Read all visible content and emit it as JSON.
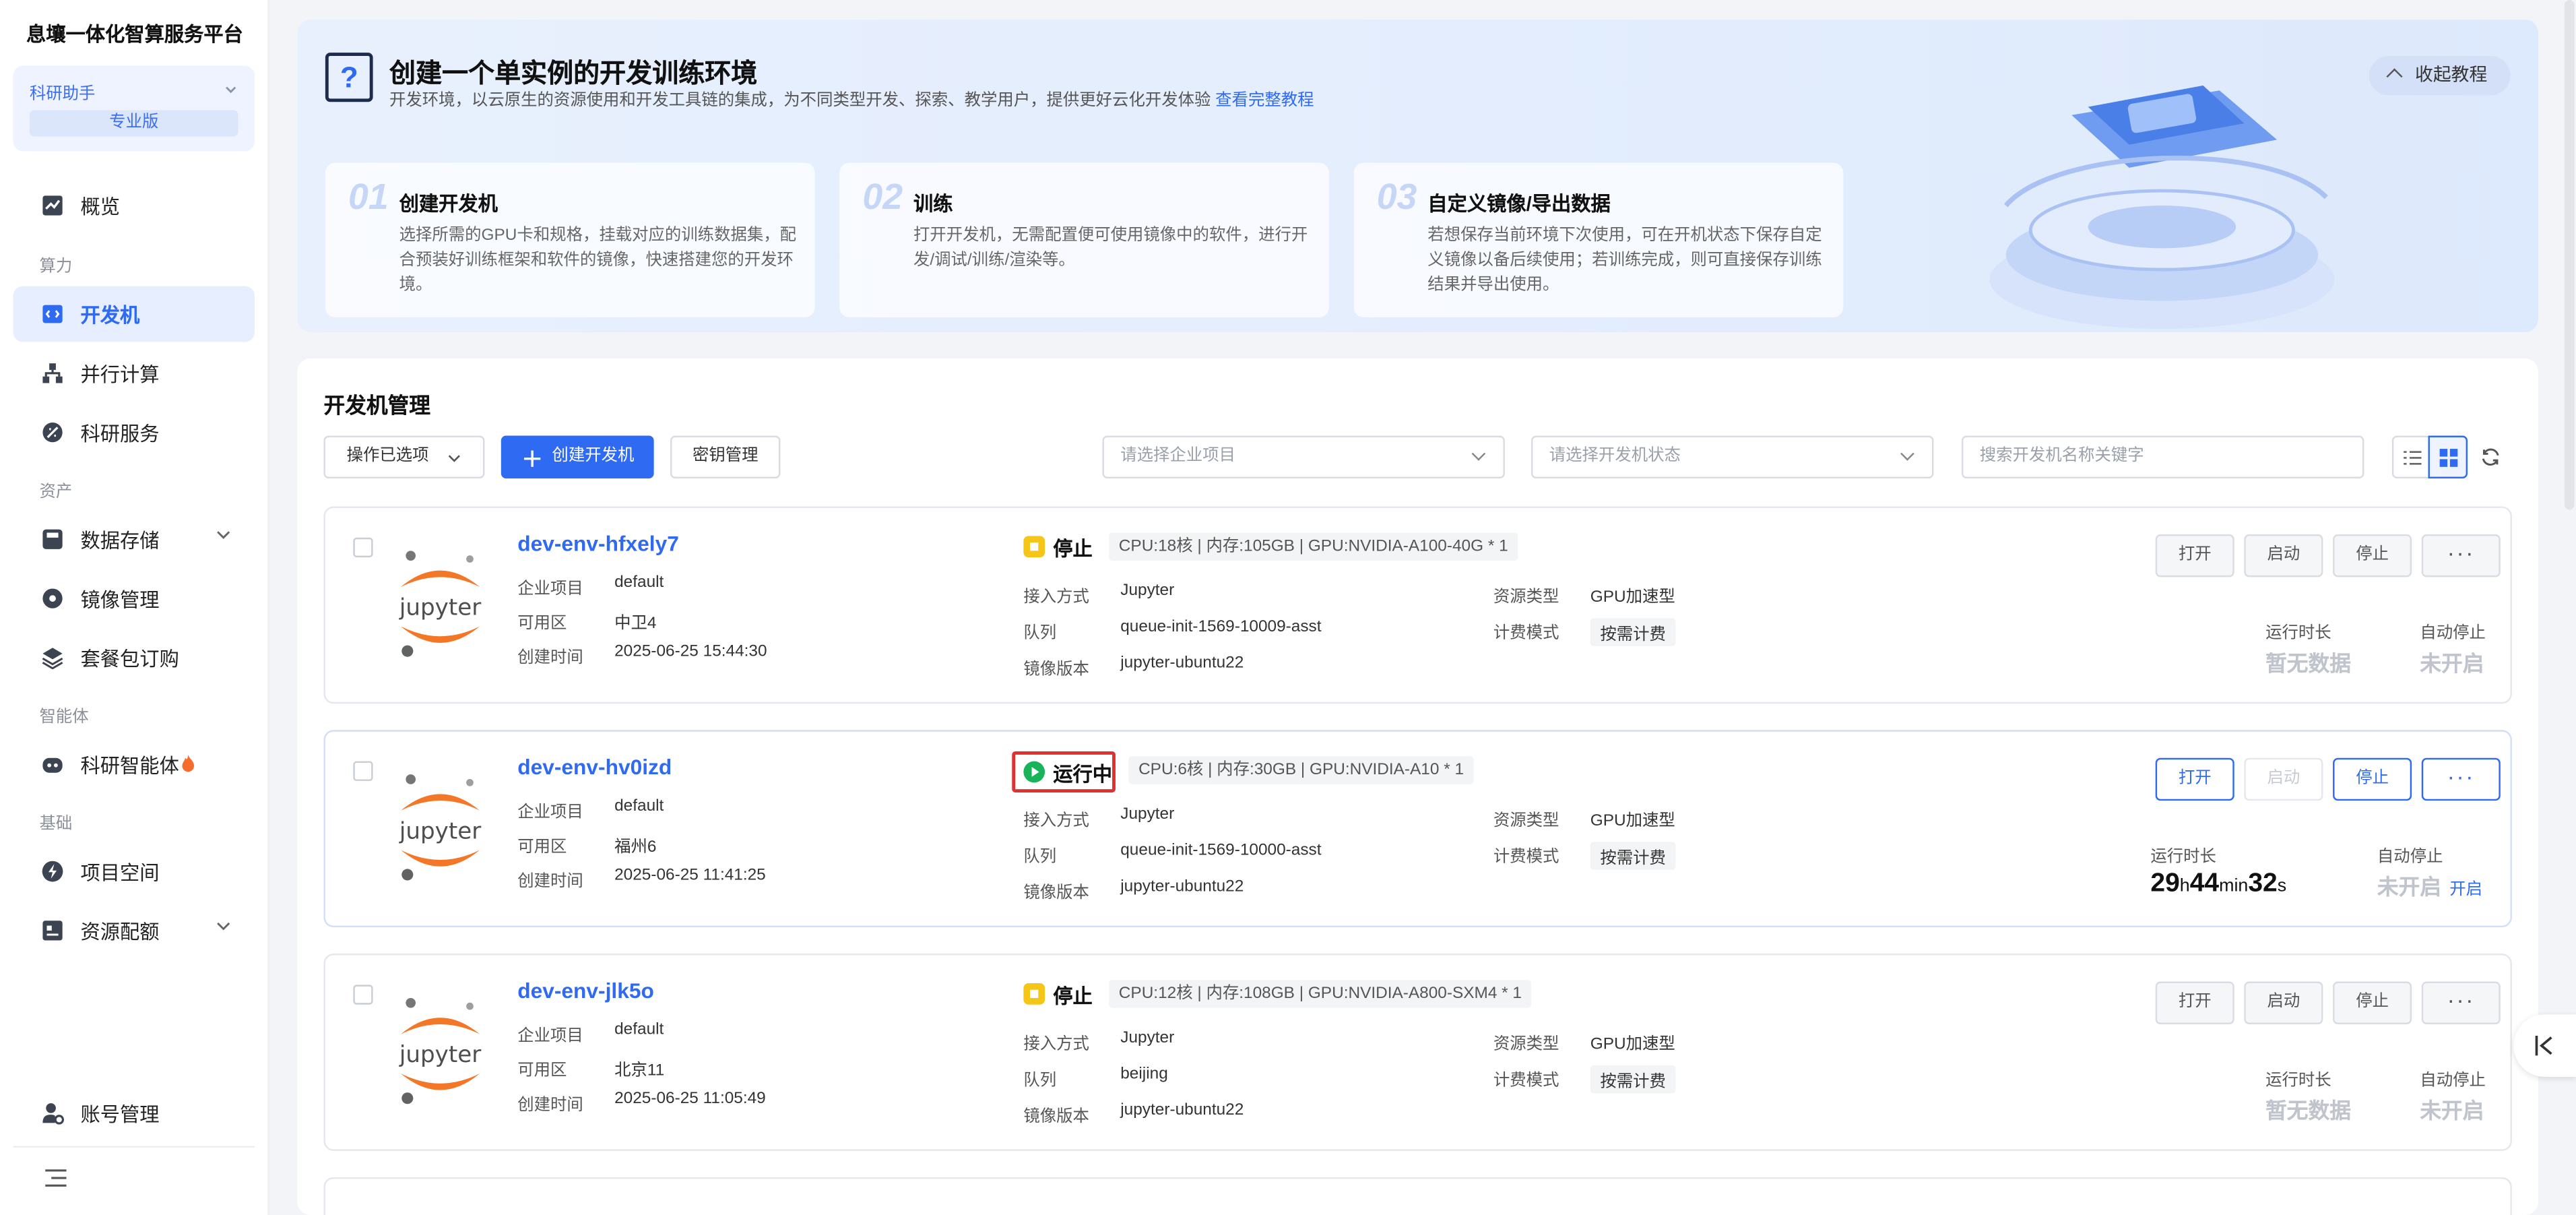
{
  "sidebar": {
    "brand": "息壤一体化智算服务平台",
    "workspace": {
      "name": "科研助手",
      "badge": "专业版"
    },
    "items": [
      {
        "label": "概览"
      },
      {
        "label": "开发机"
      },
      {
        "label": "并行计算"
      },
      {
        "label": "科研服务"
      },
      {
        "label": "数据存储"
      },
      {
        "label": "镜像管理"
      },
      {
        "label": "套餐包订购"
      },
      {
        "label": "科研智能体"
      },
      {
        "label": "项目空间"
      },
      {
        "label": "资源配额"
      }
    ],
    "sections": [
      "算力",
      "资产",
      "智能体",
      "基础"
    ],
    "account": "账号管理"
  },
  "banner": {
    "title": "创建一个单实例的开发训练环境",
    "desc": "开发环境，以云原生的资源使用和开发工具链的集成，为不同类型开发、探索、教学用户，提供更好云化开发体验",
    "link": "查看完整教程",
    "collapse": "收起教程",
    "steps": [
      {
        "num": "01",
        "title": "创建开发机",
        "desc": "选择所需的GPU卡和规格，挂载对应的训练数据集，配合预装好训练框架和软件的镜像，快速搭建您的开发环境。"
      },
      {
        "num": "02",
        "title": "训练",
        "desc": "打开开发机，无需配置便可使用镜像中的软件，进行开发/调试/训练/渲染等。"
      },
      {
        "num": "03",
        "title": "自定义镜像/导出数据",
        "desc": "若想保存当前环境下次使用，可在开机状态下保存自定义镜像以备后续使用；若训练完成，则可直接保存训练结果并导出使用。"
      }
    ]
  },
  "panel": {
    "title": "开发机管理",
    "ops": "操作已选项",
    "create": "创建开发机",
    "keys": "密钥管理",
    "project_placeholder": "请选择企业项目",
    "status_placeholder": "请选择开发机状态",
    "search_placeholder": "搜索开发机名称关键字"
  },
  "labels": {
    "project": "企业项目",
    "zone": "可用区",
    "created": "创建时间",
    "access": "接入方式",
    "queue": "队列",
    "image": "镜像版本",
    "res_type": "资源类型",
    "billing": "计费模式",
    "runtime": "运行时长",
    "auto_stop": "自动停止",
    "open": "打开",
    "start": "启动",
    "stop": "停止",
    "more": "···",
    "no_data": "暂无数据",
    "not_enabled": "未开启",
    "enable": "开启",
    "jupyter": "jupyter"
  },
  "instances": [
    {
      "name": "dev-env-hfxely7",
      "status": "停止",
      "spec": "CPU:18核 | 内存:105GB | GPU:NVIDIA-A100-40G * 1",
      "project": "default",
      "zone": "中卫4",
      "created": "2025-06-25 15:44:30",
      "access": "Jupyter",
      "queue": "queue-init-1569-10009-asst",
      "image": "jupyter-ubuntu22",
      "res_type": "GPU加速型",
      "billing": "按需计费"
    },
    {
      "name": "dev-env-hv0izd",
      "status": "运行中",
      "spec": "CPU:6核 | 内存:30GB | GPU:NVIDIA-A10 * 1",
      "project": "default",
      "zone": "福州6",
      "created": "2025-06-25 11:41:25",
      "access": "Jupyter",
      "queue": "queue-init-1569-10000-asst",
      "image": "jupyter-ubuntu22",
      "res_type": "GPU加速型",
      "billing": "按需计费",
      "runtime": {
        "h": "29",
        "m": "44",
        "s": "32",
        "hu": "h",
        "mu": "min",
        "su": "s"
      }
    },
    {
      "name": "dev-env-jlk5o",
      "status": "停止",
      "spec": "CPU:12核 | 内存:108GB | GPU:NVIDIA-A800-SXM4 * 1",
      "project": "default",
      "zone": "北京11",
      "created": "2025-06-25 11:05:49",
      "access": "Jupyter",
      "queue": "beijing",
      "image": "jupyter-ubuntu22",
      "res_type": "GPU加速型",
      "billing": "按需计费"
    }
  ],
  "colors": {
    "accent": "#2f6bf2",
    "stopped": "#f5c518",
    "running": "#19b45a",
    "highlight": "#e03030"
  }
}
